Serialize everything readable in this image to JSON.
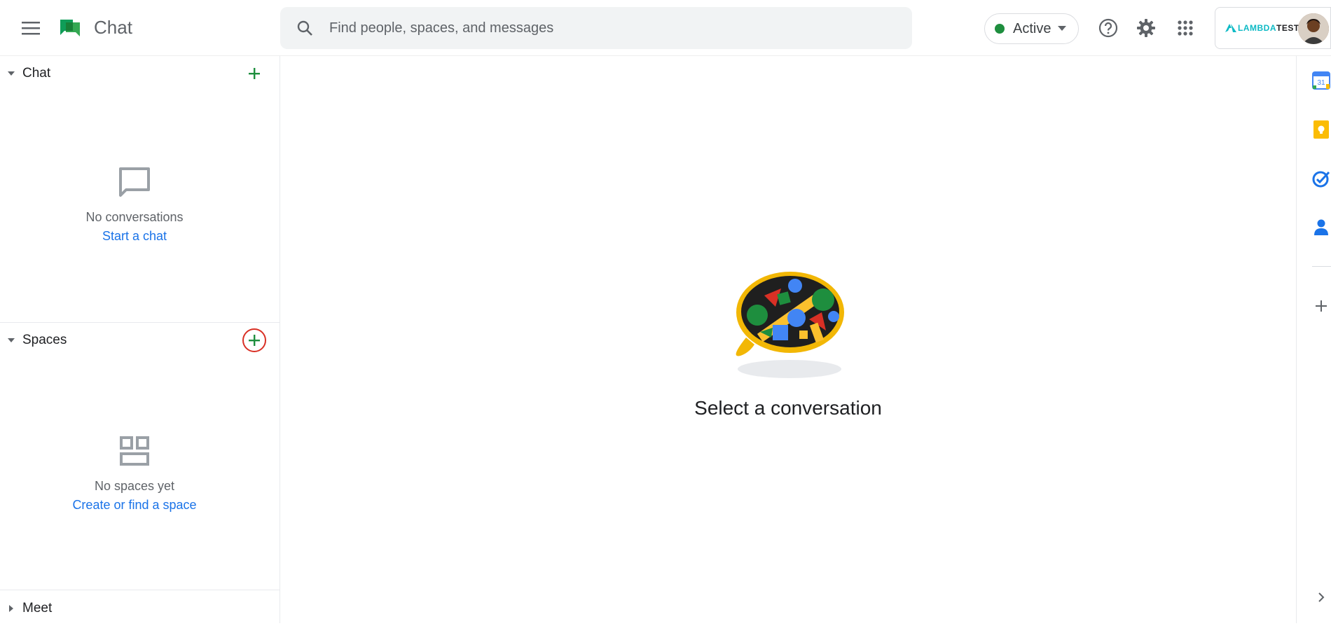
{
  "header": {
    "app_title": "Chat",
    "search_placeholder": "Find people, spaces, and messages",
    "status_label": "Active",
    "status_color": "#1e8e3e",
    "account_brand_prefix": "LAMBDA",
    "account_brand_suffix": "TEST"
  },
  "sidebar": {
    "chat_section": {
      "title": "Chat",
      "empty_message": "No conversations",
      "empty_link": "Start a chat"
    },
    "spaces_section": {
      "title": "Spaces",
      "empty_message": "No spaces yet",
      "empty_link": "Create or find a space"
    },
    "meet_section": {
      "title": "Meet"
    }
  },
  "main": {
    "placeholder_text": "Select a conversation"
  },
  "side_panel": {
    "calendar_day": "31",
    "icons": [
      "calendar-icon",
      "keep-icon",
      "tasks-icon",
      "contacts-icon",
      "add-icon",
      "chevron-right-icon"
    ]
  },
  "colors": {
    "accent_green": "#1e8e3e",
    "link_blue": "#1a73e8",
    "highlight_red": "#d93025"
  }
}
